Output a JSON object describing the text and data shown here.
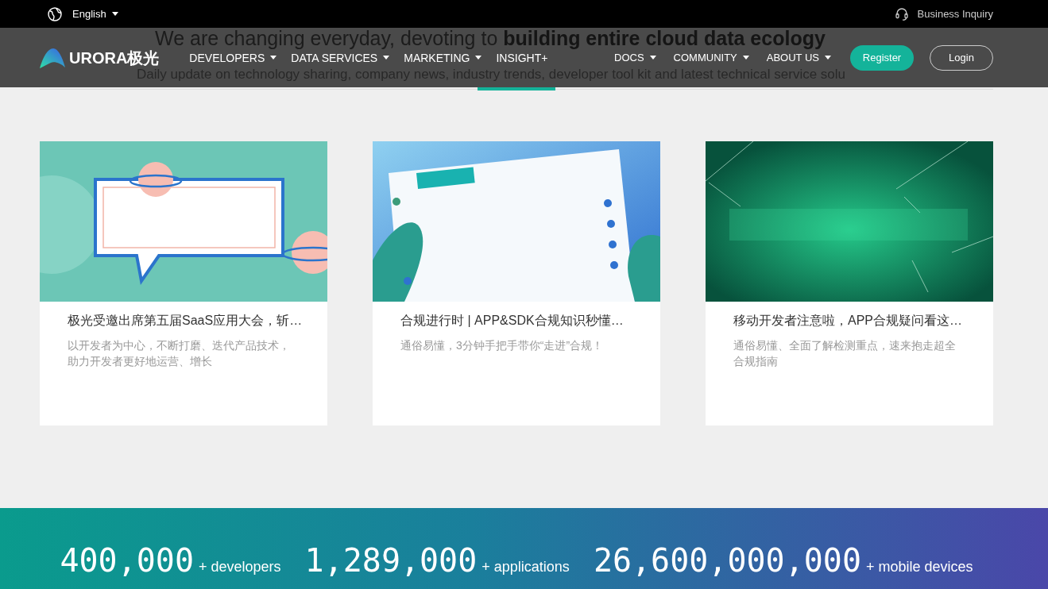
{
  "top_bar": {
    "language": "English",
    "business_link": "Business Inquiry"
  },
  "nav": {
    "logo_text": "URORA极光",
    "primary": [
      {
        "label": "DEVELOPERS",
        "dropdown": true
      },
      {
        "label": "DATA SERVICES",
        "dropdown": true
      },
      {
        "label": "MARKETING",
        "dropdown": true
      },
      {
        "label": "INSIGHT+",
        "dropdown": false
      }
    ],
    "secondary": [
      {
        "label": "DOCS",
        "dropdown": true
      },
      {
        "label": "COMMUNITY",
        "dropdown": true
      },
      {
        "label": "ABOUT US",
        "dropdown": true
      }
    ],
    "register": "Register",
    "login": "Login"
  },
  "intro": {
    "heading": "We are changing everyday, devoting to **building entire cloud data ecology**",
    "subtitle": "Daily update on technology sharing, company news, industry trends, developer tool kit and latest technical service solu"
  },
  "articles": [
    {
      "title": "极光受邀出席第五届SaaS应用大会，斩…",
      "summary": "以开发者为中心，不断打磨、迭代产品技术，助力开发者更好地运营、增长"
    },
    {
      "title": "合规进行时 | APP&SDK合规知识秒懂…",
      "summary": "通俗易懂，3分钟手把手带你“走进”合规！"
    },
    {
      "title": "移动开发者注意啦，APP合规疑问看这…",
      "summary": "通俗易懂、全面了解检测重点，速来抱走超全合规指南"
    }
  ],
  "stats": [
    {
      "count": "400,000",
      "suffix": "+ developers"
    },
    {
      "count": "1,289,000",
      "suffix": "+ applications"
    },
    {
      "count": "26,600,000,000",
      "suffix": "+ mobile devices"
    }
  ]
}
